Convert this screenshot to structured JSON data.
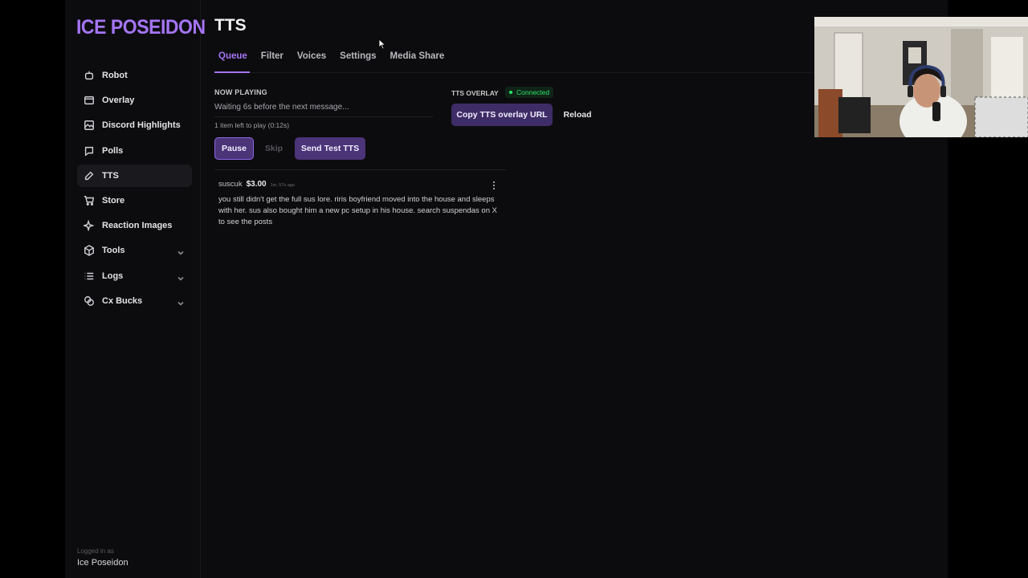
{
  "app": {
    "logo": "ICE POSEIDON",
    "logged_in_label": "Logged in as",
    "logged_in_user": "Ice Poseidon"
  },
  "sidebar": {
    "items": [
      {
        "label": "Robot",
        "icon": "robot-icon"
      },
      {
        "label": "Overlay",
        "icon": "overlay-icon"
      },
      {
        "label": "Discord Highlights",
        "icon": "gallery-icon"
      },
      {
        "label": "Polls",
        "icon": "chat-icon"
      },
      {
        "label": "TTS",
        "icon": "microphone-icon",
        "active": true
      },
      {
        "label": "Store",
        "icon": "cart-icon"
      },
      {
        "label": "Reaction Images",
        "icon": "sparkle-icon"
      },
      {
        "label": "Tools",
        "icon": "cube-icon",
        "expandable": true
      },
      {
        "label": "Logs",
        "icon": "list-icon",
        "expandable": true
      },
      {
        "label": "Cx Bucks",
        "icon": "coins-icon",
        "expandable": true
      }
    ]
  },
  "page": {
    "title": "TTS",
    "tabs": [
      {
        "label": "Queue",
        "active": true
      },
      {
        "label": "Filter"
      },
      {
        "label": "Voices"
      },
      {
        "label": "Settings"
      },
      {
        "label": "Media Share"
      }
    ]
  },
  "now_playing": {
    "heading": "NOW PLAYING",
    "status": "Waiting 6s before the next message...",
    "remaining": "1 item left to play (0:12s)"
  },
  "controls": {
    "pause": "Pause",
    "skip": "Skip",
    "send_test": "Send Test TTS"
  },
  "overlay": {
    "label": "TTS OVERLAY",
    "status": "Connected",
    "copy_button": "Copy TTS overlay URL",
    "reload_button": "Reload"
  },
  "queue": [
    {
      "user": "suscuk",
      "amount": "$3.00",
      "time": "1m, 57s ago",
      "message": "you still didn't get the full sus lore. riris boyfriend moved into the house and sleeps with her. sus also bought him a new pc setup in his house. search suspendas on X to see the posts"
    }
  ],
  "colors": {
    "accent": "#a575f5",
    "button": "#4b3478",
    "connected": "#2ee06a",
    "background": "#0c0c0e"
  }
}
